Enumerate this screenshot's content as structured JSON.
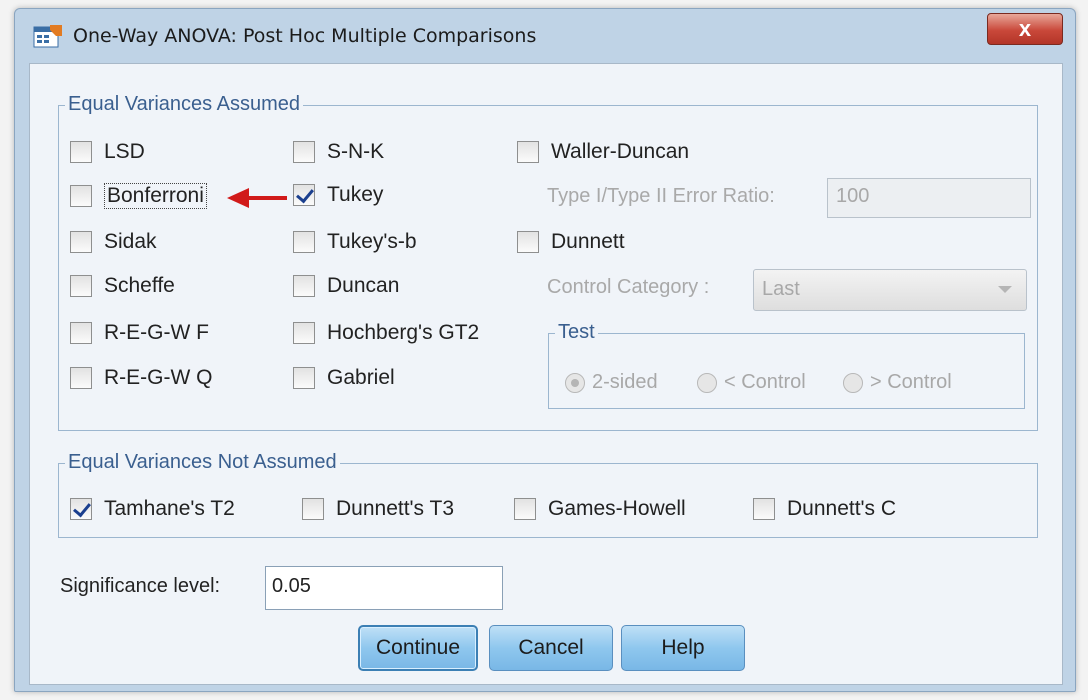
{
  "window": {
    "title": "One-Way ANOVA: Post Hoc Multiple Comparisons",
    "close_label": "x"
  },
  "equal_assumed": {
    "title": "Equal Variances Assumed",
    "col1": [
      {
        "label": "LSD",
        "checked": false
      },
      {
        "label": "Bonferroni",
        "checked": false
      },
      {
        "label": "Sidak",
        "checked": false
      },
      {
        "label": "Scheffe",
        "checked": false
      },
      {
        "label": "R-E-G-W F",
        "checked": false
      },
      {
        "label": "R-E-G-W Q",
        "checked": false
      }
    ],
    "col2": [
      {
        "label": "S-N-K",
        "checked": false
      },
      {
        "label": "Tukey",
        "checked": true
      },
      {
        "label": "Tukey's-b",
        "checked": false
      },
      {
        "label": "Duncan",
        "checked": false
      },
      {
        "label": "Hochberg's GT2",
        "checked": false
      },
      {
        "label": "Gabriel",
        "checked": false
      }
    ],
    "waller_duncan": {
      "label": "Waller-Duncan",
      "checked": false
    },
    "error_ratio": {
      "label": "Type I/Type II Error Ratio:",
      "value": "100"
    },
    "dunnett": {
      "label": "Dunnett",
      "checked": false
    },
    "control_category": {
      "label": "Control Category :",
      "value": "Last"
    },
    "test": {
      "title": "Test",
      "options": [
        "2-sided",
        "< Control",
        "> Control"
      ],
      "selected": "2-sided"
    }
  },
  "equal_not_assumed": {
    "title": "Equal Variances Not Assumed",
    "items": [
      {
        "label": "Tamhane's T2",
        "checked": true
      },
      {
        "label": "Dunnett's T3",
        "checked": false
      },
      {
        "label": "Games-Howell",
        "checked": false
      },
      {
        "label": "Dunnett's C",
        "checked": false
      }
    ]
  },
  "significance": {
    "label": "Significance level:",
    "value": "0.05"
  },
  "buttons": {
    "continue": "Continue",
    "cancel": "Cancel",
    "help": "Help"
  },
  "colors": {
    "annotation_arrow": "#d11a1a",
    "group_title": "#3a5f8f",
    "button": "#8fc7ee"
  }
}
